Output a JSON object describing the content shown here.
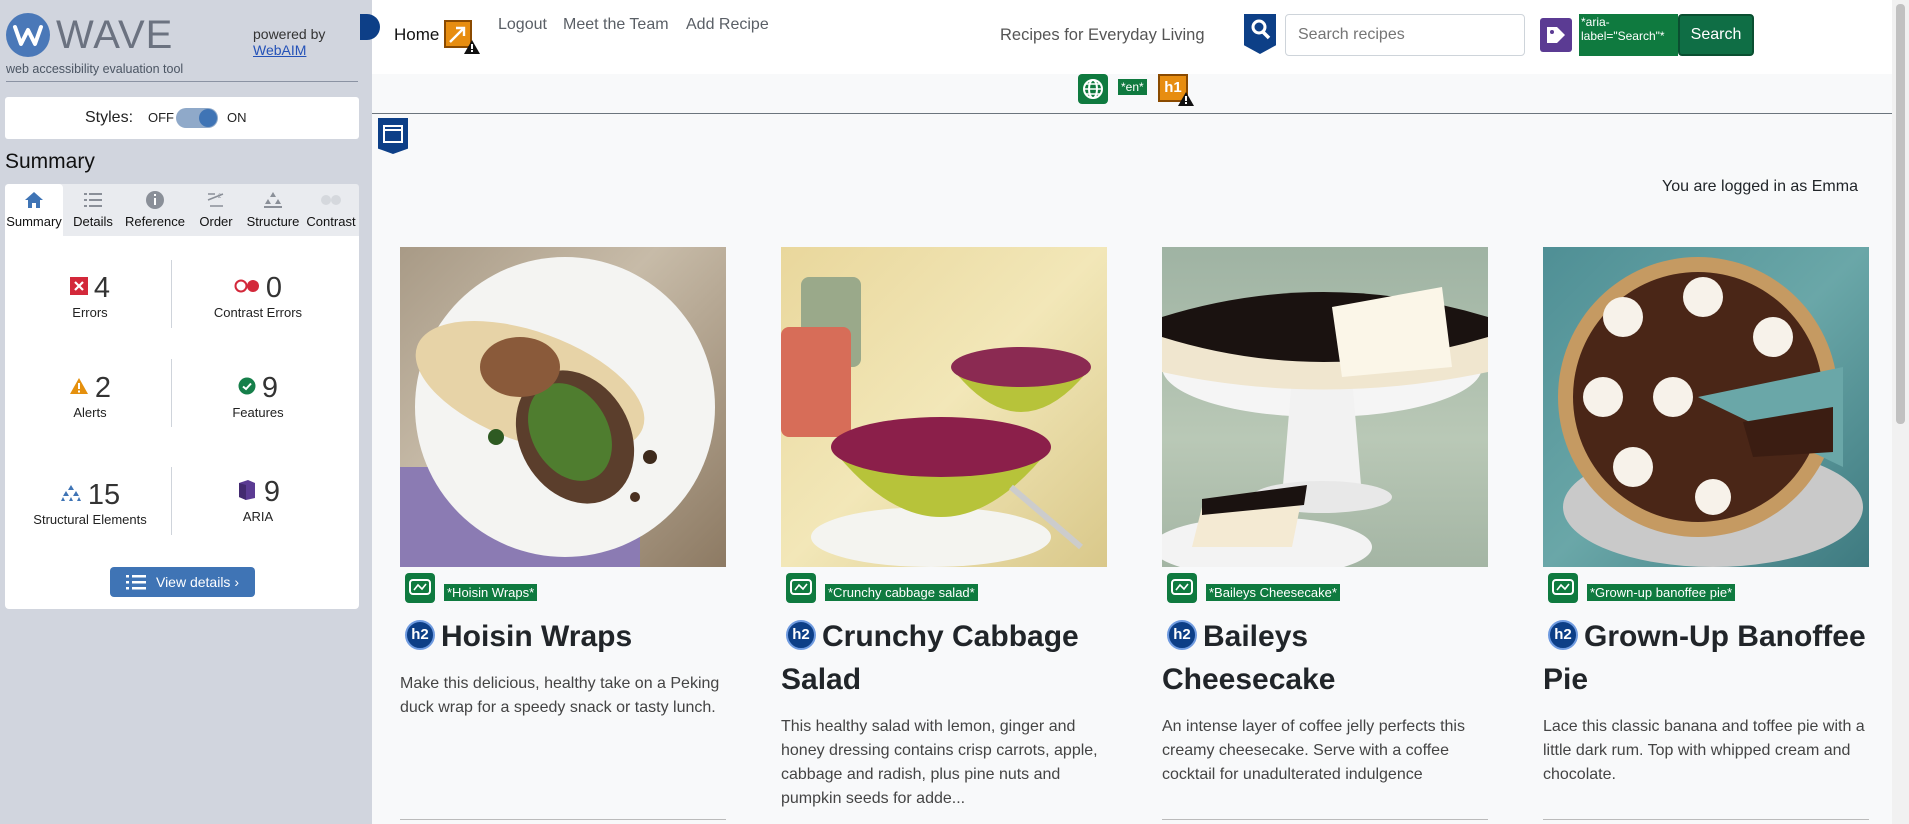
{
  "wave": {
    "wordmark": "WAVE",
    "tagline": "web accessibility evaluation tool",
    "powered_by": "powered by",
    "powered_link": "WebAIM",
    "styles_label": "Styles:",
    "styles_off": "OFF",
    "styles_on": "ON",
    "summary_title": "Summary",
    "tabs": [
      {
        "label": "Summary"
      },
      {
        "label": "Details"
      },
      {
        "label": "Reference"
      },
      {
        "label": "Order"
      },
      {
        "label": "Structure"
      },
      {
        "label": "Contrast"
      }
    ],
    "stats": {
      "errors": {
        "value": "4",
        "label": "Errors"
      },
      "contrast_errors": {
        "value": "0",
        "label": "Contrast Errors"
      },
      "alerts": {
        "value": "2",
        "label": "Alerts"
      },
      "features": {
        "value": "9",
        "label": "Features"
      },
      "structural": {
        "value": "15",
        "label": "Structural Elements"
      },
      "aria": {
        "value": "9",
        "label": "ARIA"
      }
    },
    "view_details": "View details ›",
    "colors": {
      "accent": "#3f74b5",
      "error": "#d3283a",
      "alert": "#e5900d",
      "feature": "#167f4a",
      "aria": "#5b3b93"
    }
  },
  "nav": {
    "home": "Home",
    "logout": "Logout",
    "team": "Meet the Team",
    "add_recipe": "Add Recipe",
    "brand": "Recipes for Everyday Living",
    "search_placeholder": "Search recipes",
    "aria_label_tag": "*aria-label=\"Search\"*",
    "search_button": "Search"
  },
  "lang_tag": "*en*",
  "h1_tag": "h1",
  "logged_in": "You are logged in as Emma",
  "recipes": [
    {
      "alt": "*Hoisin Wraps*",
      "title": "Hoisin Wraps",
      "desc": "Make this delicious, healthy take on a Peking duck wrap for a speedy snack or tasty lunch."
    },
    {
      "alt": "*Crunchy cabbage salad*",
      "title": "Crunchy Cabbage Salad",
      "desc": "This healthy salad with lemon, ginger and honey dressing contains crisp carrots, apple, cabbage and radish, plus pine nuts and pumpkin seeds for adde..."
    },
    {
      "alt": "*Baileys Cheesecake*",
      "title": "Baileys Cheesecake",
      "desc": "An intense layer of coffee jelly perfects this creamy cheesecake. Serve with a coffee cocktail for unadulterated indulgence"
    },
    {
      "alt": "*Grown-up banoffee pie*",
      "title": "Grown-Up Banoffee Pie",
      "desc": "Lace this classic banana and toffee pie with a little dark rum. Top with whipped cream and chocolate."
    }
  ]
}
